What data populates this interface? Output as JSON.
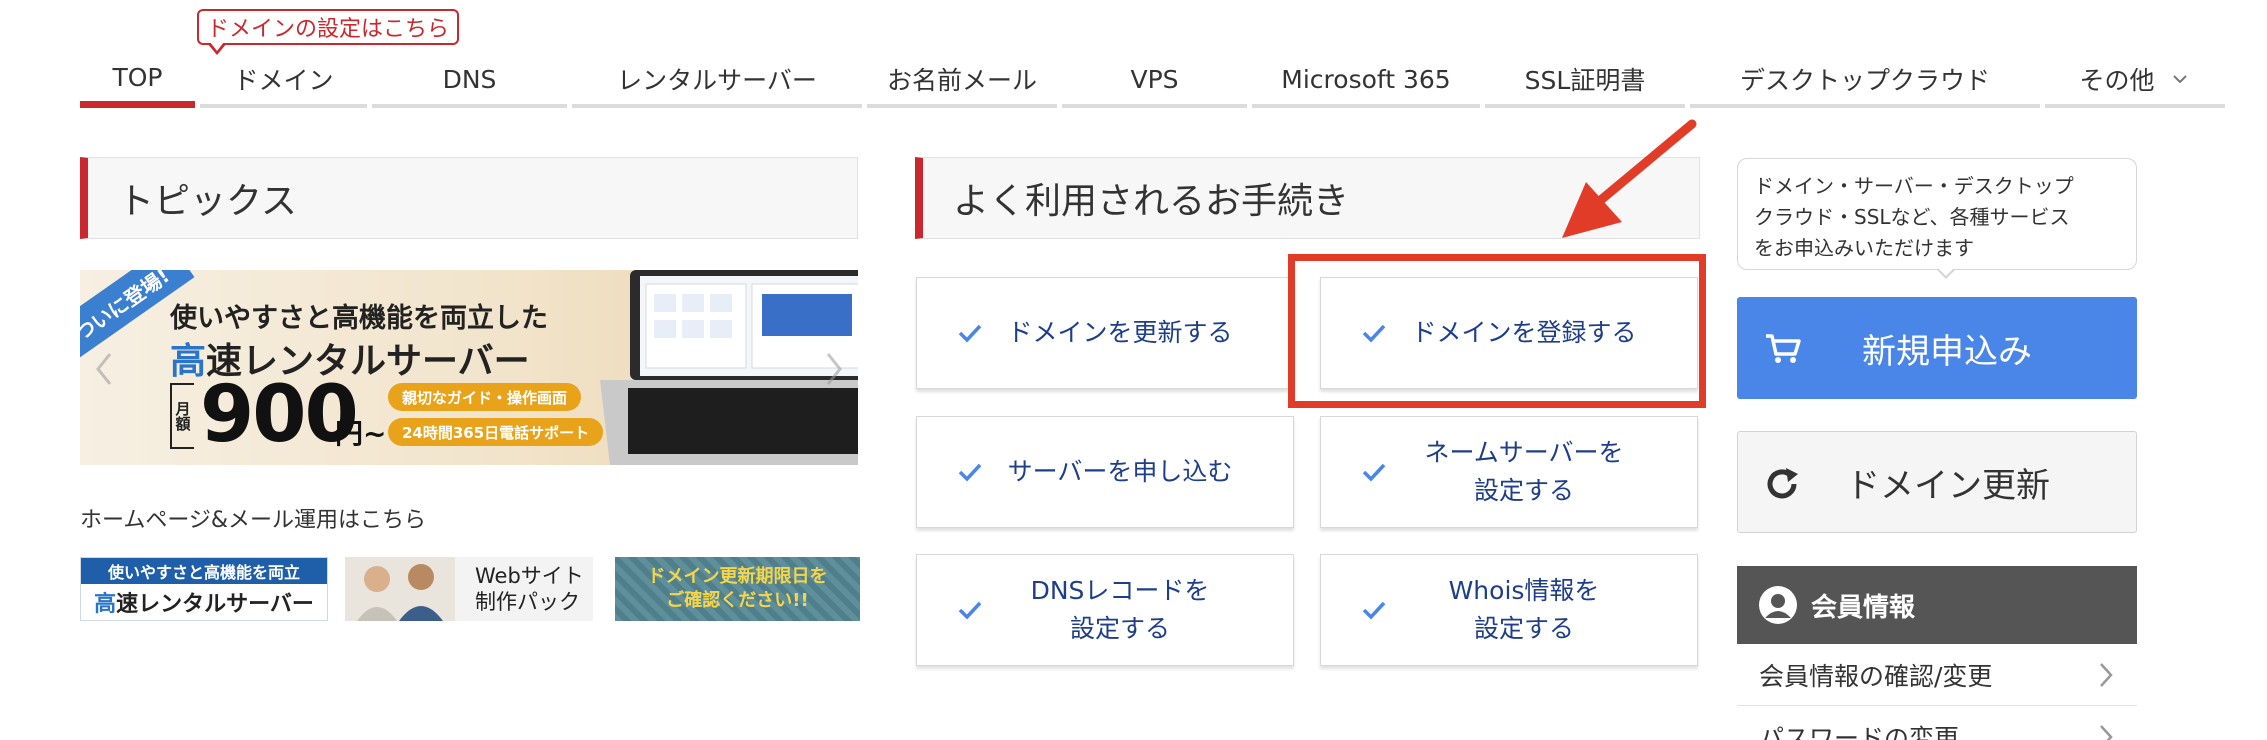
{
  "nav": {
    "tooltip": "ドメインの設定はこちら",
    "items": [
      {
        "label": "TOP"
      },
      {
        "label": "ドメイン"
      },
      {
        "label": "DNS"
      },
      {
        "label": "レンタルサーバー"
      },
      {
        "label": "お名前メール"
      },
      {
        "label": "VPS"
      },
      {
        "label": "Microsoft 365"
      },
      {
        "label": "SSL証明書"
      },
      {
        "label": "デスクトップクラウド"
      },
      {
        "label": "その他"
      }
    ],
    "active_index": 0
  },
  "topics": {
    "title": "トピックス",
    "banner": {
      "ribbon": "ついに登場!",
      "line1": "使いやすさと高機能を両立した",
      "line2_highlight": "高",
      "line2_rest": "速レンタルサーバー",
      "price_prefix": "月額",
      "price": "900",
      "price_suffix": "円~",
      "tag1": "親切なガイド・操作画面",
      "tag2": "24時間365日電話サポート"
    },
    "promo_text": "ホームページ&メール運用はこちら",
    "mini_banners": {
      "server_line1": "使いやすさと高機能を両立",
      "server_line2_highlight": "高",
      "server_line2_rest": "速レンタルサーバー",
      "web_line1": "Webサイト",
      "web_line2": "制作パック",
      "renew_line1": "ドメイン更新期限日を",
      "renew_line2": "ご確認ください!!"
    }
  },
  "procedures": {
    "title": "よく利用されるお手続き",
    "buttons": [
      {
        "line1": "ドメインを更新する",
        "line2": ""
      },
      {
        "line1": "ドメインを登録する",
        "line2": ""
      },
      {
        "line1": "サーバーを申し込む",
        "line2": ""
      },
      {
        "line1": "ネームサーバーを",
        "line2": "設定する"
      },
      {
        "line1": "DNSレコードを",
        "line2": "設定する"
      },
      {
        "line1": "Whois情報を",
        "line2": "設定する"
      }
    ]
  },
  "sidebar": {
    "bubble_line1": "ドメイン・サーバー・デスクトップ",
    "bubble_line2": "クラウド・SSLなど、各種サービス",
    "bubble_line3": "をお申込みいただけます",
    "new_button": "新規申込み",
    "renew_button": "ドメイン更新",
    "member_title": "会員情報",
    "member_links": [
      {
        "label": "会員情報の確認/変更"
      },
      {
        "label": "パスワードの変更"
      }
    ]
  },
  "colors": {
    "accent_red": "#c8282e",
    "annotation_red": "#e03c28",
    "primary_blue": "#4a86e8",
    "link_navy": "#1e3e8a",
    "header_gray": "#555555"
  }
}
